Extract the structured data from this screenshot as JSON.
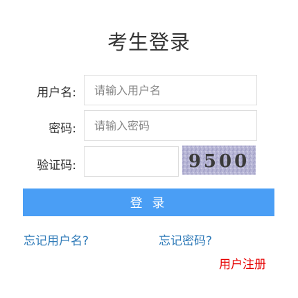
{
  "page": {
    "title": "考生登录"
  },
  "form": {
    "username_label": "用户名:",
    "username_placeholder": "请输入用户名",
    "username_value": "",
    "password_label": "密码:",
    "password_placeholder": "请输入密码",
    "password_value": "",
    "captcha_label": "验证码:",
    "captcha_value": "",
    "captcha_image_text": "9500",
    "login_label": "登 录"
  },
  "links": {
    "forgot_username": "忘记用户名?",
    "forgot_password": "忘记密码?",
    "register": "用户注册"
  },
  "colors": {
    "primary_button": "#4a9ef5",
    "link_blue": "#2e7ab8",
    "link_red": "#e60000"
  }
}
